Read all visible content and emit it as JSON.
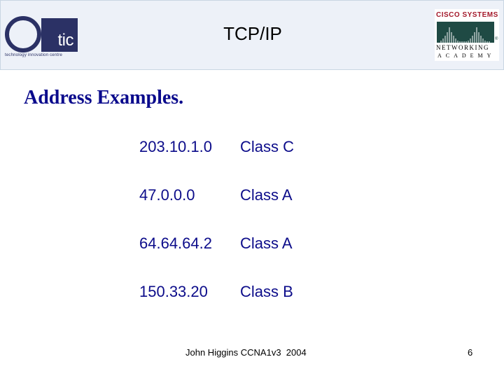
{
  "header": {
    "title": "TCP/IP",
    "left_logo": {
      "mark": "tic",
      "tagline": "technology innovation centre",
      "color": "#2b3165"
    },
    "right_logo": {
      "name": "Cisco Systems",
      "line1": "Networking",
      "line2": "ACADEMY",
      "reg": "®",
      "name_color": "#a3182a",
      "band_color": "#1f4a44"
    }
  },
  "section_title": "Address Examples.",
  "examples": [
    {
      "address": "203.10.1.0",
      "class": "Class  C"
    },
    {
      "address": "47.0.0.0",
      "class": "Class A"
    },
    {
      "address": "64.64.64.2",
      "class": "Class  A"
    },
    {
      "address": "150.33.20",
      "class": "Class  B"
    }
  ],
  "footer": {
    "text": "John Higgins CCNA1v3  2004",
    "page_number": "6"
  },
  "colors": {
    "header_bg": "#edf1f8",
    "heading": "#0a0a8c",
    "body_text": "#0c0c8a"
  }
}
